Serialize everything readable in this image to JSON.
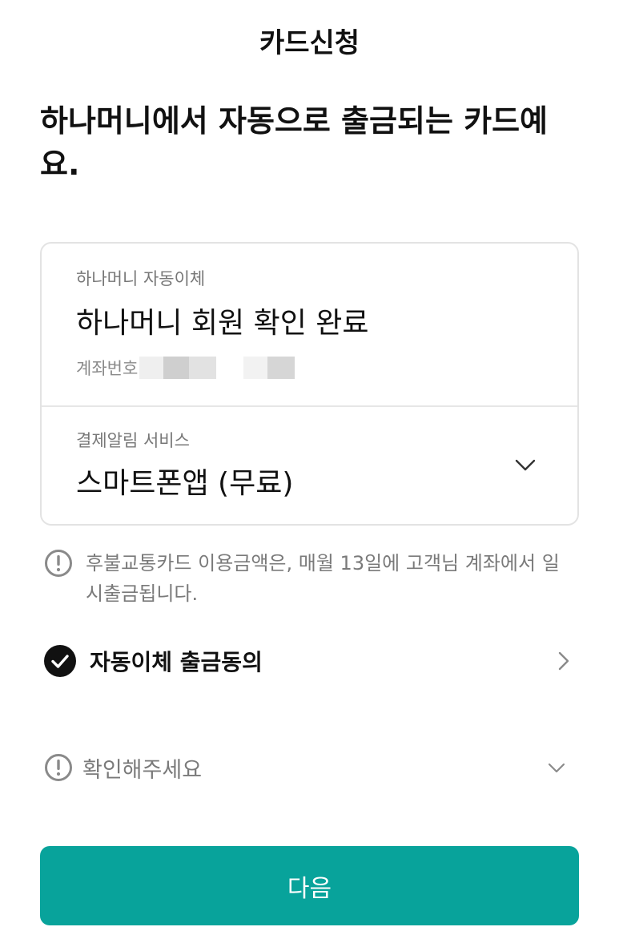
{
  "header": {
    "title": "카드신청"
  },
  "headline": "하나머니에서 자동으로 출금되는 카드예요.",
  "auto_transfer": {
    "label": "하나머니 자동이체",
    "status": "하나머니 회원 확인 완료",
    "account_label": "계좌번호"
  },
  "payment_alert": {
    "label": "결제알림 서비스",
    "selected": "스마트폰앱 (무료)"
  },
  "notice": {
    "icon": "exclamation-circle-icon",
    "text": "후불교통카드 이용금액은, 매월 13일에 고객님 계좌에서 일시출금됩니다."
  },
  "consent": {
    "icon": "check-circle-icon",
    "label": "자동이체 출금동의",
    "checked": true
  },
  "confirm": {
    "icon": "exclamation-circle-icon",
    "label": "확인해주세요"
  },
  "footer": {
    "next_label": "다음"
  },
  "colors": {
    "primary": "#08a39b",
    "text": "#111111",
    "muted": "#7a7a7a",
    "border": "#e3e3e3"
  }
}
